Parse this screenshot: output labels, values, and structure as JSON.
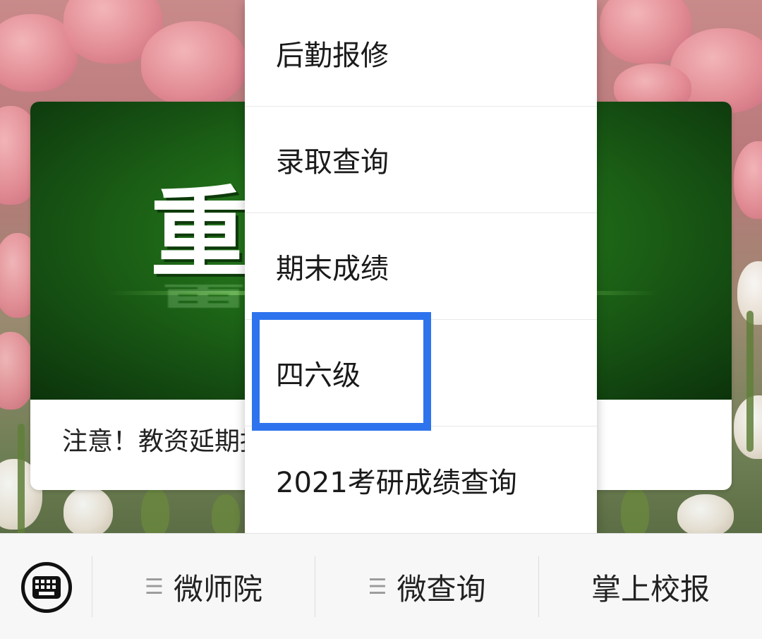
{
  "background": {
    "accent": "#e58d96",
    "leaf": "#6b8a3e"
  },
  "article": {
    "cover_title": "重要通知",
    "summary": "注意！教资延期报名通知"
  },
  "popup_menu": {
    "items": [
      {
        "label": "后勤报修"
      },
      {
        "label": "录取查询"
      },
      {
        "label": "期末成绩"
      },
      {
        "label": "四六级"
      },
      {
        "label": "2021考研成绩查询"
      }
    ],
    "highlighted_item": "四六级",
    "highlight_color": "#2e73ee"
  },
  "bottom_bar": {
    "keyboard_icon": "keyboard-icon",
    "tabs": [
      {
        "label": "微师院",
        "icon": "menu-lines-icon"
      },
      {
        "label": "微查询",
        "icon": "menu-lines-icon"
      },
      {
        "label": "掌上校报"
      }
    ]
  }
}
